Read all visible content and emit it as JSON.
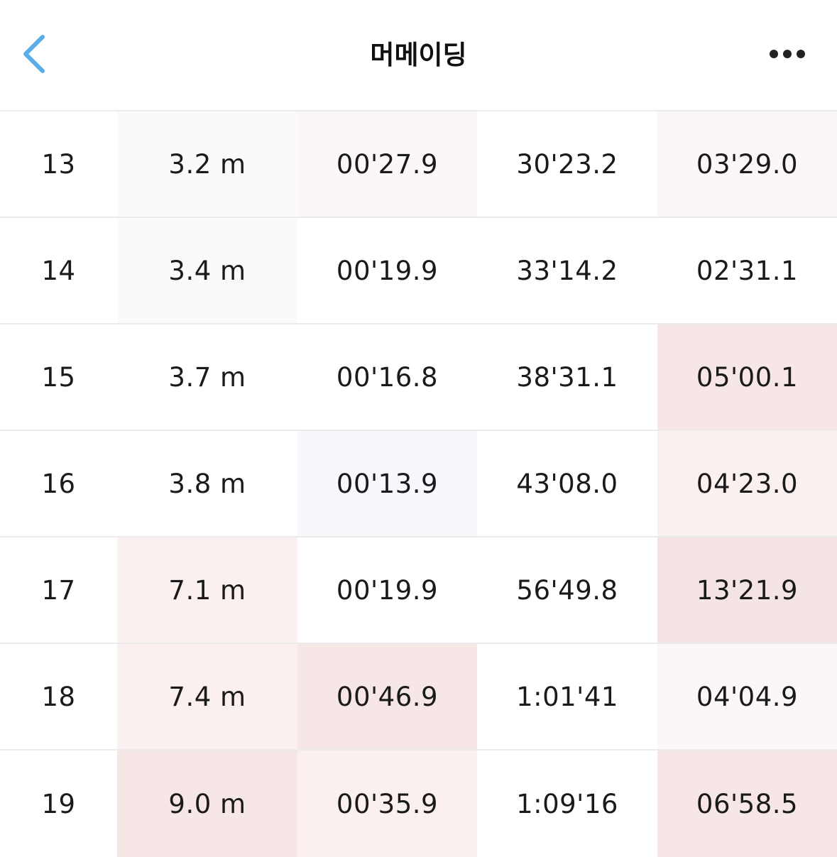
{
  "header": {
    "title": "머메이딩",
    "back_icon": "chevron-left-icon",
    "more_icon": "more-horizontal-icon",
    "accent_color": "#5aaee8"
  },
  "table": {
    "rows": [
      {
        "lap": "13",
        "distance": "3.2 m",
        "split": "00'27.9",
        "total": "30'23.2",
        "rest": "03'29.0"
      },
      {
        "lap": "14",
        "distance": "3.4 m",
        "split": "00'19.9",
        "total": "33'14.2",
        "rest": "02'31.1"
      },
      {
        "lap": "15",
        "distance": "3.7 m",
        "split": "00'16.8",
        "total": "38'31.1",
        "rest": "05'00.1"
      },
      {
        "lap": "16",
        "distance": "3.8 m",
        "split": "00'13.9",
        "total": "43'08.0",
        "rest": "04'23.0"
      },
      {
        "lap": "17",
        "distance": "7.1 m",
        "split": "00'19.9",
        "total": "56'49.8",
        "rest": "13'21.9"
      },
      {
        "lap": "18",
        "distance": "7.4 m",
        "split": "00'46.9",
        "total": "1:01'41",
        "rest": "04'04.9"
      },
      {
        "lap": "19",
        "distance": "9.0 m",
        "split": "00'35.9",
        "total": "1:09'16",
        "rest": "06'58.5"
      }
    ]
  }
}
